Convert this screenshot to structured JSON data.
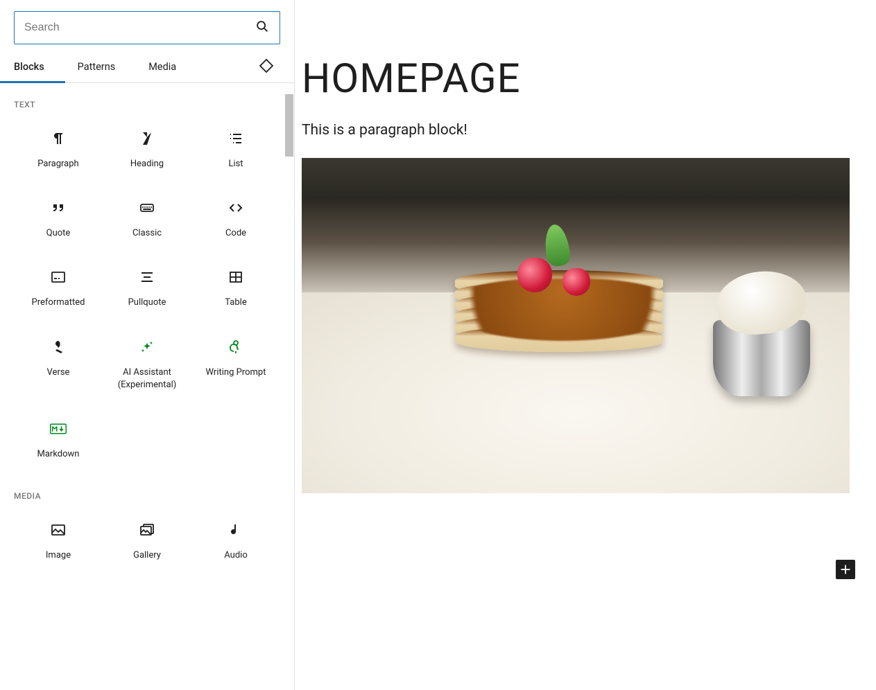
{
  "sidebar": {
    "search": {
      "placeholder": "Search"
    },
    "tabs": [
      {
        "label": "Blocks",
        "active": true
      },
      {
        "label": "Patterns",
        "active": false
      },
      {
        "label": "Media",
        "active": false
      }
    ],
    "sections": [
      {
        "title": "TEXT",
        "items": [
          {
            "id": "paragraph",
            "label": "Paragraph"
          },
          {
            "id": "heading",
            "label": "Heading"
          },
          {
            "id": "list",
            "label": "List"
          },
          {
            "id": "quote",
            "label": "Quote"
          },
          {
            "id": "classic",
            "label": "Classic"
          },
          {
            "id": "code",
            "label": "Code"
          },
          {
            "id": "preformatted",
            "label": "Preformatted"
          },
          {
            "id": "pullquote",
            "label": "Pullquote"
          },
          {
            "id": "table",
            "label": "Table"
          },
          {
            "id": "verse",
            "label": "Verse"
          },
          {
            "id": "ai-assistant",
            "label": "AI Assistant (Experimental)",
            "green": true
          },
          {
            "id": "writing-prompt",
            "label": "Writing Prompt",
            "green": true
          },
          {
            "id": "markdown",
            "label": "Markdown",
            "green": true
          }
        ]
      },
      {
        "title": "MEDIA",
        "items": [
          {
            "id": "image",
            "label": "Image"
          },
          {
            "id": "gallery",
            "label": "Gallery"
          },
          {
            "id": "audio",
            "label": "Audio"
          }
        ]
      }
    ]
  },
  "canvas": {
    "title": "HOMEPAGE",
    "paragraph": "This is a paragraph block!"
  }
}
